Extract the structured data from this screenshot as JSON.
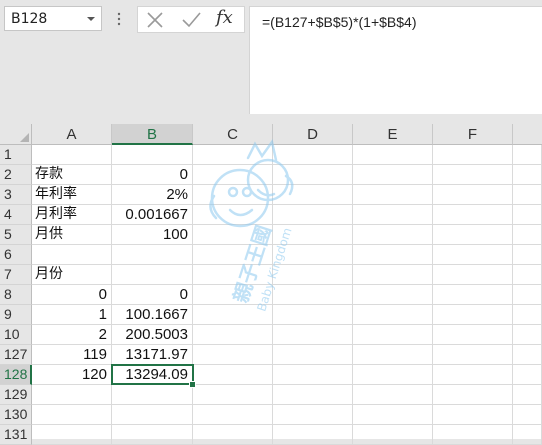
{
  "name_box": {
    "value": "B128"
  },
  "formula_bar": {
    "formula": "=(B127+$B$5)*(1+$B$4)",
    "fx_label": "fx"
  },
  "columns": [
    "A",
    "B",
    "C",
    "D",
    "E",
    "F"
  ],
  "selected_column": "B",
  "selected_row": "128",
  "rows": [
    {
      "num": "1",
      "a": "",
      "b": ""
    },
    {
      "num": "2",
      "a": "存款",
      "b": "0"
    },
    {
      "num": "3",
      "a": "年利率",
      "b": "2%"
    },
    {
      "num": "4",
      "a": "月利率",
      "b": "0.001667"
    },
    {
      "num": "5",
      "a": "月供",
      "b": "100"
    },
    {
      "num": "6",
      "a": "",
      "b": ""
    },
    {
      "num": "7",
      "a": "月份",
      "b": ""
    },
    {
      "num": "8",
      "a": "0",
      "b": "0"
    },
    {
      "num": "9",
      "a": "1",
      "b": "100.1667"
    },
    {
      "num": "10",
      "a": "2",
      "b": "200.5003"
    },
    {
      "num": "127",
      "a": "119",
      "b": "13171.97"
    },
    {
      "num": "128",
      "a": "120",
      "b": "13294.09"
    },
    {
      "num": "129",
      "a": "",
      "b": ""
    },
    {
      "num": "130",
      "a": "",
      "b": ""
    },
    {
      "num": "131",
      "a": "",
      "b": ""
    }
  ],
  "watermark": {
    "text_cn": "親子王國",
    "text_en": "Baby Kingdom"
  },
  "colors": {
    "accent": "#217346",
    "header_bg": "#e6e6e6",
    "grid_line": "#dadada"
  }
}
